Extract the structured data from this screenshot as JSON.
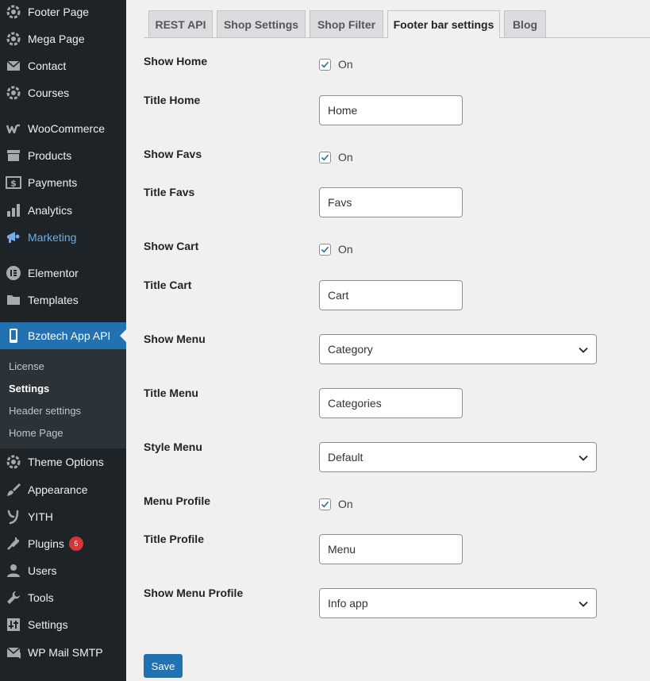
{
  "sidebar": {
    "items": [
      {
        "label": "Footer Page",
        "icon": "bzotech-gear-icon"
      },
      {
        "label": "Mega Page",
        "icon": "bzotech-gear-icon"
      },
      {
        "label": "Contact",
        "icon": "envelope-icon"
      },
      {
        "label": "Courses",
        "icon": "bzotech-gear-icon"
      },
      {
        "label": "WooCommerce",
        "icon": "woo-icon"
      },
      {
        "label": "Products",
        "icon": "archive-icon"
      },
      {
        "label": "Payments",
        "icon": "dollar-card-icon"
      },
      {
        "label": "Analytics",
        "icon": "bar-chart-icon"
      },
      {
        "label": "Marketing",
        "icon": "megaphone-icon"
      },
      {
        "label": "Elementor",
        "icon": "elementor-icon"
      },
      {
        "label": "Templates",
        "icon": "folder-icon"
      },
      {
        "label": "Bzotech App API",
        "icon": "phone-icon"
      },
      {
        "label": "Theme Options",
        "icon": "bzotech-gear-icon"
      },
      {
        "label": "Appearance",
        "icon": "paintbrush-icon"
      },
      {
        "label": "YITH",
        "icon": "yith-icon"
      },
      {
        "label": "Plugins",
        "icon": "plug-icon",
        "badge": "5"
      },
      {
        "label": "Users",
        "icon": "user-icon"
      },
      {
        "label": "Tools",
        "icon": "wrench-icon"
      },
      {
        "label": "Settings",
        "icon": "sliders-icon"
      },
      {
        "label": "WP Mail SMTP",
        "icon": "mail-icon"
      }
    ],
    "submenu": [
      "License",
      "Settings",
      "Header settings",
      "Home Page"
    ]
  },
  "tabs": [
    "REST API",
    "Shop Settings",
    "Shop Filter",
    "Footer bar settings",
    "Blog"
  ],
  "form": {
    "show_home": {
      "label": "Show Home",
      "checked": true,
      "text": "On"
    },
    "title_home": {
      "label": "Title Home",
      "value": "Home"
    },
    "show_favs": {
      "label": "Show Favs",
      "checked": true,
      "text": "On"
    },
    "title_favs": {
      "label": "Title Favs",
      "value": "Favs"
    },
    "show_cart": {
      "label": "Show Cart",
      "checked": true,
      "text": "On"
    },
    "title_cart": {
      "label": "Title Cart",
      "value": "Cart"
    },
    "show_menu": {
      "label": "Show Menu",
      "value": "Category"
    },
    "title_menu": {
      "label": "Title Menu",
      "value": "Categories"
    },
    "style_menu": {
      "label": "Style Menu",
      "value": "Default"
    },
    "menu_profile": {
      "label": "Menu Profile",
      "checked": true,
      "text": "On"
    },
    "title_profile": {
      "label": "Title Profile",
      "value": "Menu"
    },
    "show_menu_profile": {
      "label": "Show Menu Profile",
      "value": "Info app"
    }
  },
  "save_label": "Save",
  "colors": {
    "sidebar_bg": "#1d2327",
    "accent": "#2271b1",
    "marketing": "#72aee6",
    "badge": "#d63638"
  }
}
